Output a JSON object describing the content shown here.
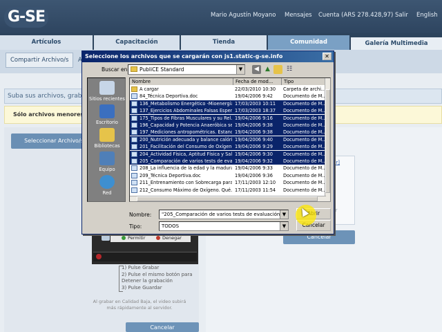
{
  "site": {
    "logo": "G-SE",
    "user_name": "Mario Agustín Moyano",
    "links": [
      "Mensajes",
      "Cuenta (ARS 278.428,97)",
      "Salir",
      "English"
    ]
  },
  "nav": {
    "tabs": [
      "Artículos",
      "Capacitación",
      "Tienda",
      "Comunidad",
      "Galería Multimedia"
    ]
  },
  "subnav": {
    "share_button": "Compartir Archivo/s",
    "fragment": "A"
  },
  "info_text": "Suba sus archivos, grabe v",
  "warning_text": "Sólo archivos menores",
  "select_files_button": "Seleccionar Archivo/s",
  "right_panel": {
    "link_fragment": "var]",
    "disabled_fragment": "ardar",
    "cancel": "Cancelar"
  },
  "recorder": {
    "allow": "Permitir",
    "deny": "Denegar",
    "steps": [
      "1) Pulse Grabar",
      "2) Pulse el mismo botón para Detener la grabación",
      "3) Pulse Guardar"
    ],
    "note": "Al grabar en Calidad Baja, el video subirá más rápidamente al servidor.",
    "cancel": "Cancelar"
  },
  "dialog": {
    "title": "Seleccione los archivos que se cargarán con js1.static-g-se.info",
    "look_in_label": "Buscar en:",
    "look_in_value": "PubliCE Standard",
    "places": [
      "Sitios recientes",
      "Escritorio",
      "Bibliotecas",
      "Equipo",
      "Red"
    ],
    "columns": [
      "Nombre",
      "Fecha de mod...",
      "Tipo"
    ],
    "files": [
      {
        "name": "A cargar",
        "date": "22/03/2010 10:30",
        "type": "Carpeta de archi...",
        "selected": false,
        "folder": true
      },
      {
        "name": "84_Técnica Deportiva.doc",
        "date": "19/04/2006 9:42",
        "type": "Documento de M...",
        "selected": false,
        "folder": false
      },
      {
        "name": "136_Metabolismo Energético -Mioenergía...",
        "date": "17/03/2003 10:11",
        "type": "Documento de M...",
        "selected": true,
        "folder": false
      },
      {
        "name": "137_Ejercicios Abdominales Falsas Esper...",
        "date": "17/03/2003 18:37",
        "type": "Documento de M...",
        "selected": true,
        "folder": false
      },
      {
        "name": "175_Tipos de Fibras Musculares y su Rel...",
        "date": "19/04/2006 9:16",
        "type": "Documento de M...",
        "selected": true,
        "folder": false
      },
      {
        "name": "196_Capacidad y Potencia Anaeróbica se...",
        "date": "19/04/2006 9:38",
        "type": "Documento de M...",
        "selected": true,
        "folder": false
      },
      {
        "name": "197_Mediciones antropométricas. Estand...",
        "date": "19/04/2006 9:38",
        "type": "Documento de M...",
        "selected": true,
        "folder": false
      },
      {
        "name": "200_Nutrición adecuada y balance calóric...",
        "date": "19/04/2006 9:40",
        "type": "Documento de M...",
        "selected": true,
        "folder": false
      },
      {
        "name": "201_Facilitación del Consumo de Oxígeno...",
        "date": "19/04/2006 9:29",
        "type": "Documento de M...",
        "selected": true,
        "folder": false
      },
      {
        "name": "204_Actividad Física, Aptitud Física y Sal...",
        "date": "19/04/2006 9:30",
        "type": "Documento de M...",
        "selected": true,
        "folder": false
      },
      {
        "name": "205_Comparación de varios tests de eval...",
        "date": "19/04/2006 9:32",
        "type": "Documento de M...",
        "selected": true,
        "folder": false
      },
      {
        "name": "208_La influencia de la edad y la madura...",
        "date": "19/04/2006 9:33",
        "type": "Documento de M...",
        "selected": false,
        "folder": false
      },
      {
        "name": "209_Técnica Deportiva.doc",
        "date": "19/04/2006 9:36",
        "type": "Documento de M...",
        "selected": false,
        "folder": false
      },
      {
        "name": "211_Entrenamiento con Sobrecarga para...",
        "date": "17/11/2003 12:10",
        "type": "Documento de M...",
        "selected": false,
        "folder": false
      },
      {
        "name": "212_Consumo Máximo de Oxígeno. Qué...",
        "date": "17/11/2003 11:54",
        "type": "Documento de M...",
        "selected": false,
        "folder": false
      }
    ],
    "name_label": "Nombre:",
    "name_value": "\"205_Comparación de varios tests de evaluación física p",
    "type_label": "Tipo:",
    "type_value": "TODOS",
    "open_button": "Abrir",
    "cancel_button": "Cancelar"
  }
}
